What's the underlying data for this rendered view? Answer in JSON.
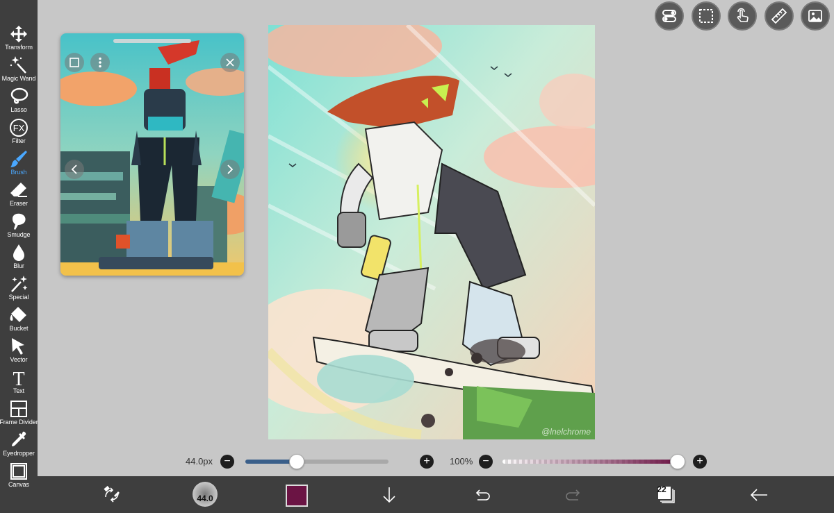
{
  "toolbar": {
    "items": [
      {
        "label": "Transform",
        "icon": "move-icon"
      },
      {
        "label": "Magic Wand",
        "icon": "magic-wand-icon"
      },
      {
        "label": "Lasso",
        "icon": "lasso-icon"
      },
      {
        "label": "Filter",
        "icon": "fx-icon",
        "glyph": "FX"
      },
      {
        "label": "Brush",
        "icon": "brush-icon",
        "active": true
      },
      {
        "label": "Eraser",
        "icon": "eraser-icon"
      },
      {
        "label": "Smudge",
        "icon": "smudge-icon"
      },
      {
        "label": "Blur",
        "icon": "blur-drop-icon"
      },
      {
        "label": "Special",
        "icon": "sparkle-icon"
      },
      {
        "label": "Bucket",
        "icon": "bucket-icon"
      },
      {
        "label": "Vector",
        "icon": "arrow-pointer-icon"
      },
      {
        "label": "Text",
        "icon": "text-icon",
        "glyph": "T"
      },
      {
        "label": "Frame Divider",
        "icon": "frame-divider-icon"
      },
      {
        "label": "Eyedropper",
        "icon": "eyedropper-icon"
      },
      {
        "label": "Canvas",
        "icon": "canvas-icon"
      }
    ],
    "active_color": "#4aa8ff"
  },
  "top_buttons": [
    "toggle-icon",
    "selection-icon",
    "touch-icon",
    "ruler-icon",
    "image-icon"
  ],
  "brush_size": {
    "label": "44.0px",
    "value_fraction": 0.36,
    "fill_color": "#3a5f8a"
  },
  "opacity": {
    "label": "100%",
    "value_fraction": 1.0
  },
  "bottom_bar": {
    "brush_preview_label": "44.0",
    "current_color": "#6b1444",
    "layer_count": "22"
  },
  "canvas": {
    "signature": "@lnelchrome"
  }
}
